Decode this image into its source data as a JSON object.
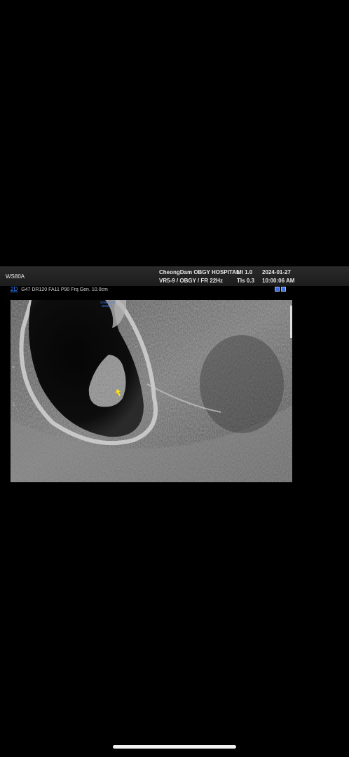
{
  "header": {
    "device_model": "WS80A",
    "hospital": "CheongDam OBGY HOSPITAL",
    "probe_preset": "VR5-9 / OBGY / FR 22Hz",
    "mi": "MI  1.0",
    "tis": "TIs 0.3",
    "date": "2024-01-27",
    "time": "10:00:06 AM"
  },
  "params": {
    "mode": "2D",
    "settings": "G47 DR120 FA11 P90 Frq Gen. 10.0cm"
  },
  "scan": {
    "watermark_line1": "SAMSUNG",
    "watermark_line2": "WS80A",
    "depth_marker": "5"
  },
  "colors": {
    "background": "#000000",
    "header_bar": "#222222",
    "mode_accent": "#3c82ff",
    "cursor": "#ffe600"
  },
  "icons": [
    "probe-orientation-icon",
    "cursor-icon",
    "display-mode-icon"
  ]
}
